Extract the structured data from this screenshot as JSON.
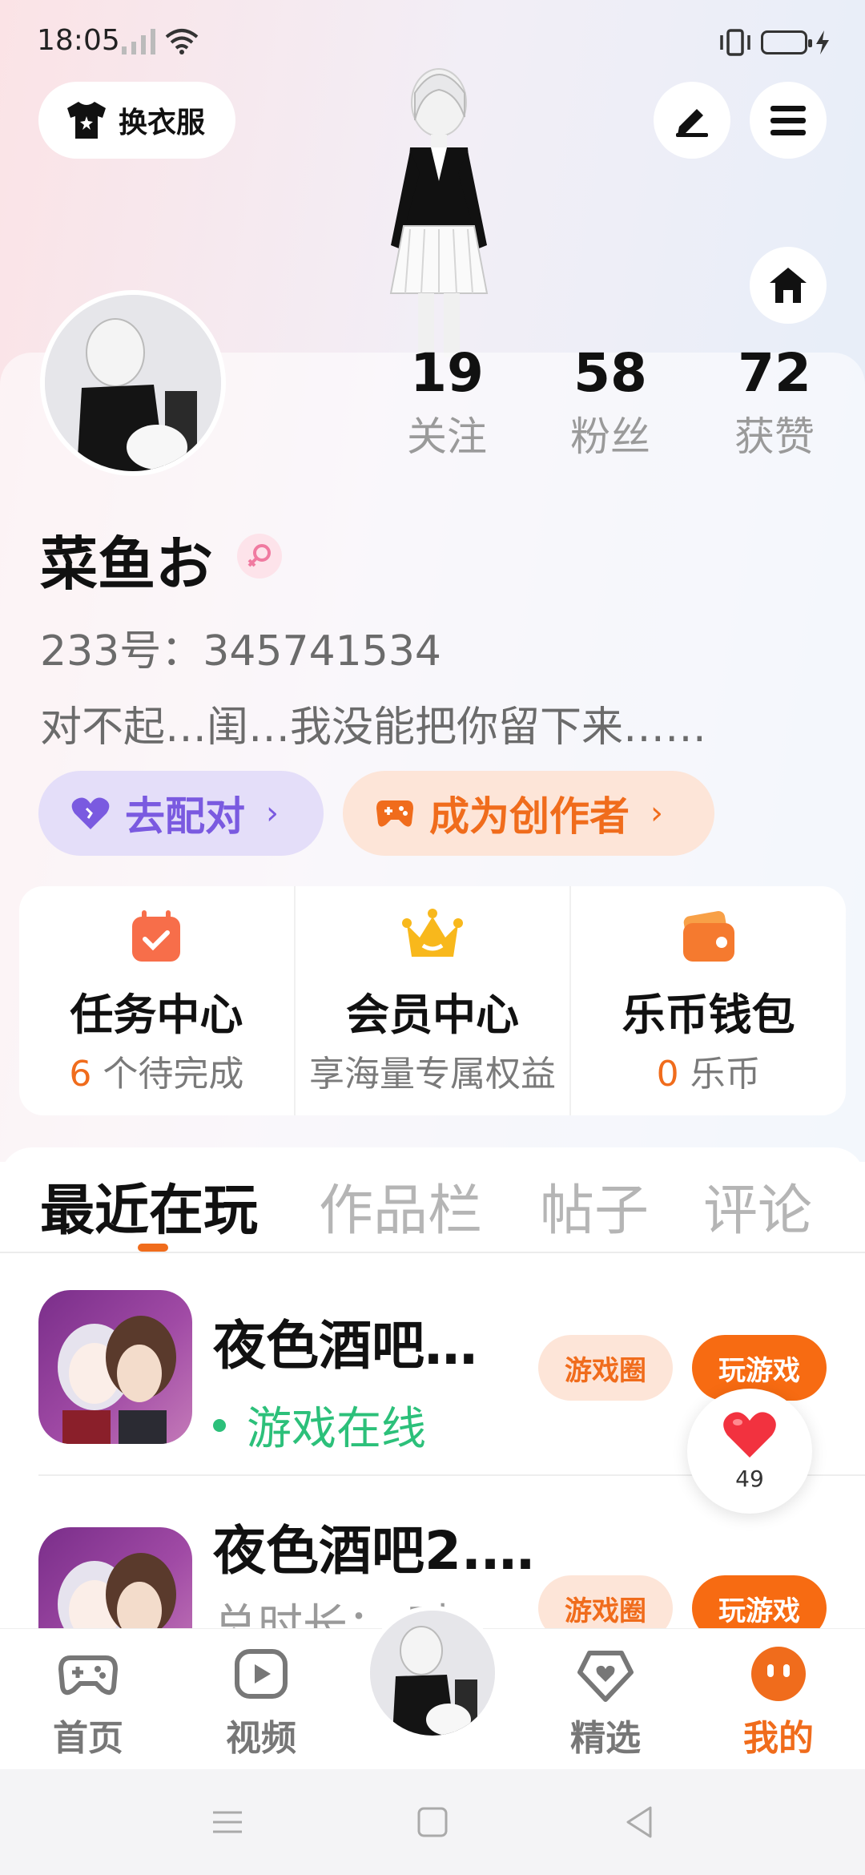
{
  "status_bar": {
    "time": "18:05"
  },
  "header": {
    "outfit_label": "换衣服"
  },
  "stats": [
    {
      "value": "19",
      "label": "关注"
    },
    {
      "value": "58",
      "label": "粉丝"
    },
    {
      "value": "72",
      "label": "获赞"
    }
  ],
  "profile": {
    "name": "菜鱼お",
    "id_text": "233号：345741534",
    "bio": "对不起…闺…我没能把你留下来……"
  },
  "actions": {
    "match_label": "去配对",
    "creator_label": "成为创作者",
    "chevron": "›"
  },
  "services": [
    {
      "title": "任务中心",
      "highlight": "6",
      "sub": " 个待完成"
    },
    {
      "title": "会员中心",
      "sub": "享海量专属权益"
    },
    {
      "title": "乐币钱包",
      "highlight": "0",
      "sub": " 乐币"
    }
  ],
  "tabs": [
    "最近在玩",
    "作品栏",
    "帖子",
    "评论"
  ],
  "games": [
    {
      "title": "夜色酒吧…",
      "status": "游戏在线",
      "circle_label": "游戏圈",
      "play_label": "玩游戏"
    },
    {
      "title": "夜色酒吧2.…",
      "sub": "总时长：    时",
      "circle_label": "游戏圈",
      "play_label": "玩游戏"
    }
  ],
  "likes": {
    "count": "49"
  },
  "bottom_nav": [
    {
      "label": "首页"
    },
    {
      "label": "视频"
    },
    {
      "label": "精选"
    },
    {
      "label": "我的"
    }
  ],
  "colors": {
    "accent": "#f06c1c",
    "purple": "#7a5ae0",
    "online": "#2cc07a"
  }
}
